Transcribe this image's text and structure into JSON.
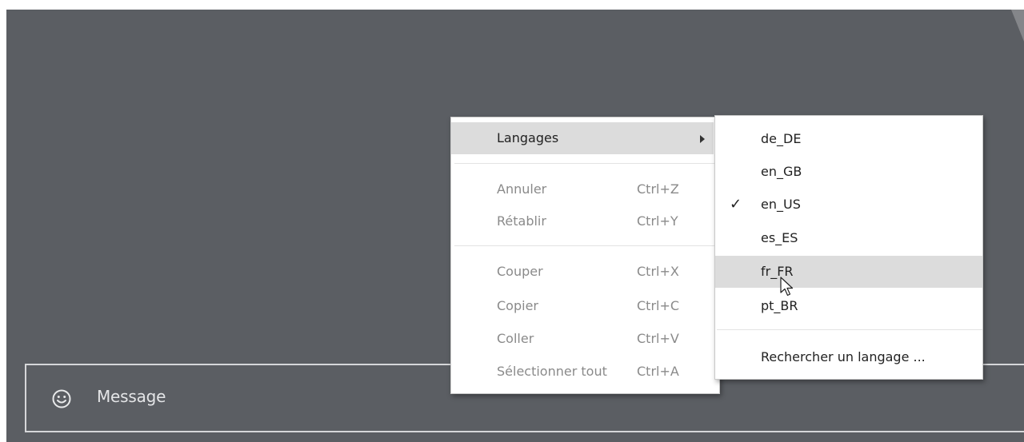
{
  "composer": {
    "placeholder": "Message",
    "emoji_icon": "smiley-face-icon"
  },
  "context_menu": {
    "items": [
      {
        "label": "Langages",
        "has_submenu": true,
        "highlighted": true
      },
      {
        "label": "Annuler",
        "shortcut": "Ctrl+Z",
        "disabled": true
      },
      {
        "label": "Rétablir",
        "shortcut": "Ctrl+Y",
        "disabled": true
      },
      {
        "label": "Couper",
        "shortcut": "Ctrl+X",
        "disabled": true
      },
      {
        "label": "Copier",
        "shortcut": "Ctrl+C",
        "disabled": true
      },
      {
        "label": "Coller",
        "shortcut": "Ctrl+V",
        "disabled": true
      },
      {
        "label": "Sélectionner tout",
        "shortcut": "Ctrl+A",
        "disabled": true
      }
    ]
  },
  "language_submenu": {
    "items": [
      {
        "label": "de_DE",
        "checked": false
      },
      {
        "label": "en_GB",
        "checked": false
      },
      {
        "label": "en_US",
        "checked": true
      },
      {
        "label": "es_ES",
        "checked": false
      },
      {
        "label": "fr_FR",
        "checked": false,
        "hovered": true
      },
      {
        "label": "pt_BR",
        "checked": false
      }
    ],
    "search_label": "Rechercher un langage ...",
    "check_glyph": "✓"
  },
  "colors": {
    "background": "#5b5e63",
    "menu_highlight": "#dcdcdc",
    "disabled_text": "#8a8a8a"
  }
}
